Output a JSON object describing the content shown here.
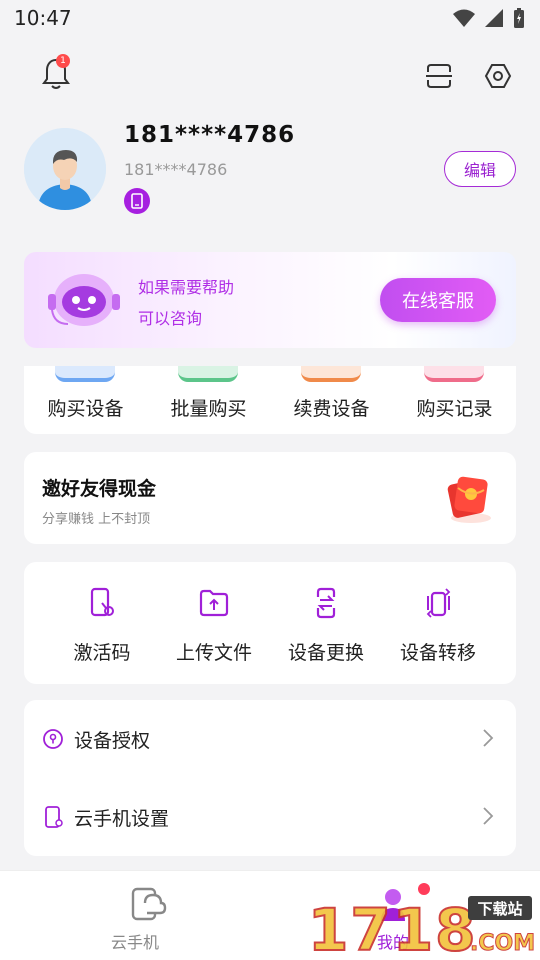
{
  "status_bar": {
    "time": "10:47"
  },
  "header": {
    "notification_count": "1"
  },
  "profile": {
    "name": "181****4786",
    "sub": "181****4786",
    "edit_label": "编辑"
  },
  "support": {
    "line1": "如果需要帮助",
    "line2": "可以咨询",
    "button_label": "在线客服"
  },
  "purchase": {
    "items": [
      {
        "label": "购买设备",
        "color": "#6ea7f2"
      },
      {
        "label": "批量购买",
        "color": "#5cc58a"
      },
      {
        "label": "续费设备",
        "color": "#f08a4a"
      },
      {
        "label": "购买记录",
        "color": "#ef6c8a"
      }
    ]
  },
  "invite": {
    "title": "邀好友得现金",
    "subtitle": "分享赚钱 上不封顶"
  },
  "tools": {
    "items": [
      {
        "label": "激活码",
        "icon": "activation-code-icon"
      },
      {
        "label": "上传文件",
        "icon": "upload-file-icon"
      },
      {
        "label": "设备更换",
        "icon": "device-swap-icon"
      },
      {
        "label": "设备转移",
        "icon": "device-transfer-icon"
      }
    ]
  },
  "list": {
    "items": [
      {
        "label": "设备授权",
        "icon": "lock-icon"
      },
      {
        "label": "云手机设置",
        "icon": "phone-settings-icon"
      }
    ]
  },
  "tabbar": {
    "items": [
      {
        "label": "云手机"
      },
      {
        "label": "我的"
      }
    ]
  },
  "watermark": {
    "main": "1718",
    "tag": "下载站",
    "domain": ".COM"
  },
  "colors": {
    "accent": "#a020d8",
    "badge": "#ff4b4b"
  }
}
